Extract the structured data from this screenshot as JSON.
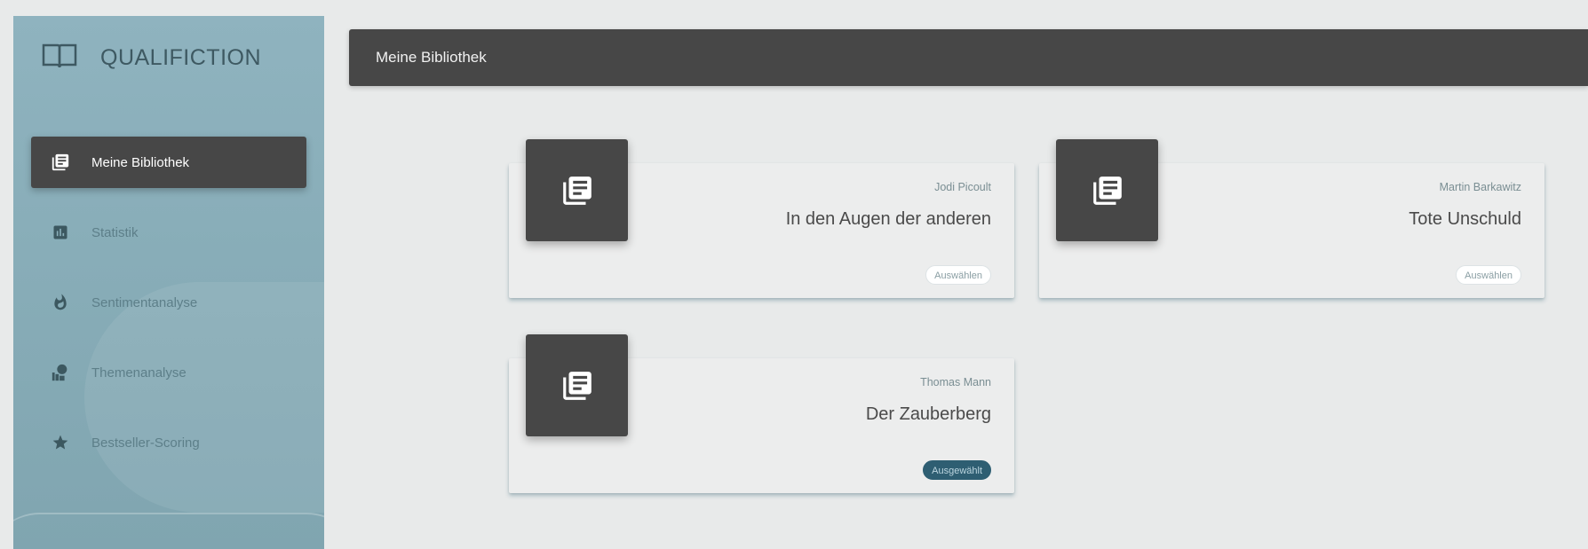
{
  "app": {
    "brand_name": "QUALIFICTION",
    "brand_icon": "open-book-icon"
  },
  "sidebar": {
    "items": [
      {
        "label": "Meine Bibliothek",
        "icon": "library-books-icon",
        "active": true
      },
      {
        "label": "Statistik",
        "icon": "bar-chart-icon",
        "active": false
      },
      {
        "label": "Sentimentanalyse",
        "icon": "flame-icon",
        "active": false
      },
      {
        "label": "Themenanalyse",
        "icon": "topic-bubbles-icon",
        "active": false
      },
      {
        "label": "Bestseller-Scoring",
        "icon": "star-icon",
        "active": false
      }
    ]
  },
  "header": {
    "title": "Meine Bibliothek"
  },
  "books": [
    {
      "author": "Jodi Picoult",
      "title": "In den Augen der anderen",
      "button": "Auswählen",
      "selected": false,
      "icon": "library-books-icon"
    },
    {
      "author": "Martin Barkawitz",
      "title": "Tote Unschuld",
      "button": "Auswählen",
      "selected": false,
      "icon": "library-books-icon"
    },
    {
      "author": "Thomas Mann",
      "title": "Der Zauberberg",
      "button": "Ausgewählt",
      "selected": true,
      "icon": "library-books-icon"
    }
  ],
  "colors": {
    "sidebar_bg": "#88adb8",
    "dark": "#474747",
    "selected_badge": "#2e5e72",
    "page_bg": "#e8eaea"
  }
}
